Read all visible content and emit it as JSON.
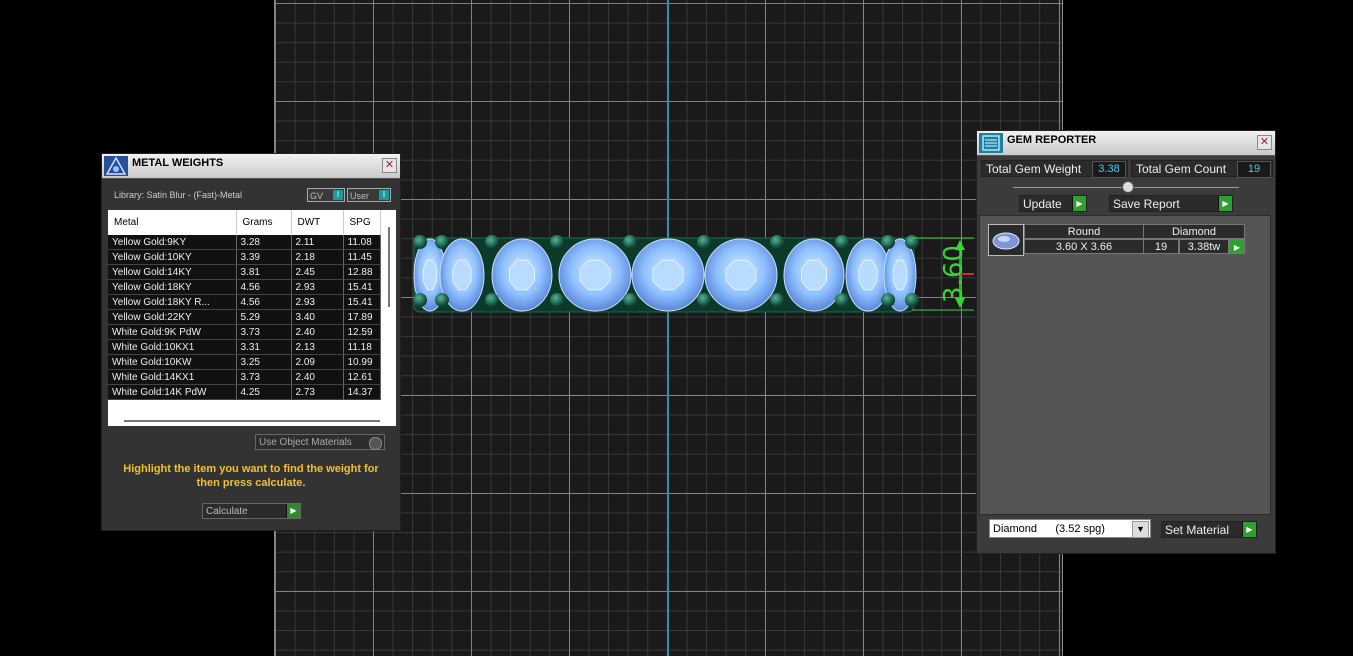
{
  "metal_weights": {
    "title": "METAL WEIGHTS",
    "library": "Library: Satin Blur - (Fast)-Metal",
    "toggle_gv": "GV",
    "toggle_user": "User",
    "columns": [
      "Metal",
      "Grams",
      "DWT",
      "SPG"
    ],
    "rows": [
      [
        "Yellow Gold:9KY",
        "3.28",
        "2.11",
        "11.08"
      ],
      [
        "Yellow Gold:10KY",
        "3.39",
        "2.18",
        "11.45"
      ],
      [
        "Yellow Gold:14KY",
        "3.81",
        "2.45",
        "12.88"
      ],
      [
        "Yellow Gold:18KY",
        "4.56",
        "2.93",
        "15.41"
      ],
      [
        "Yellow Gold:18KY R...",
        "4.56",
        "2.93",
        "15.41"
      ],
      [
        "Yellow Gold:22KY",
        "5.29",
        "3.40",
        "17.89"
      ],
      [
        "White Gold:9K PdW",
        "3.73",
        "2.40",
        "12.59"
      ],
      [
        "White Gold:10KX1",
        "3.31",
        "2.13",
        "11.18"
      ],
      [
        "White Gold:10KW",
        "3.25",
        "2.09",
        "10.99"
      ],
      [
        "White Gold:14KX1",
        "3.73",
        "2.40",
        "12.61"
      ],
      [
        "White Gold:14K PdW",
        "4.25",
        "2.73",
        "14.37"
      ]
    ],
    "use_object_materials": "Use Object Materials",
    "hint": "Highlight the item you want to find the weight for then press calculate.",
    "calculate_label": "Calculate"
  },
  "gem_reporter": {
    "title": "GEM REPORTER",
    "total_gem_weight_label": "Total Gem Weight",
    "total_gem_weight": "3.38",
    "total_gem_count_label": "Total Gem Count",
    "total_gem_count": "19",
    "update_label": "Update",
    "save_report_label": "Save Report",
    "gem_row": {
      "cut": "Round",
      "material": "Diamond",
      "size": "3.60 X 3.66",
      "count": "19",
      "weight": "3.38tw"
    },
    "material_select": "Diamond      (3.52 spg)",
    "set_material_label": "Set Material"
  },
  "viewport": {
    "dimension_label": "3.60",
    "colors": {
      "gem": "#8fc0ff",
      "prong": "#1f6b55",
      "dimension": "#33d633",
      "axis": "#2f8fa8"
    }
  }
}
